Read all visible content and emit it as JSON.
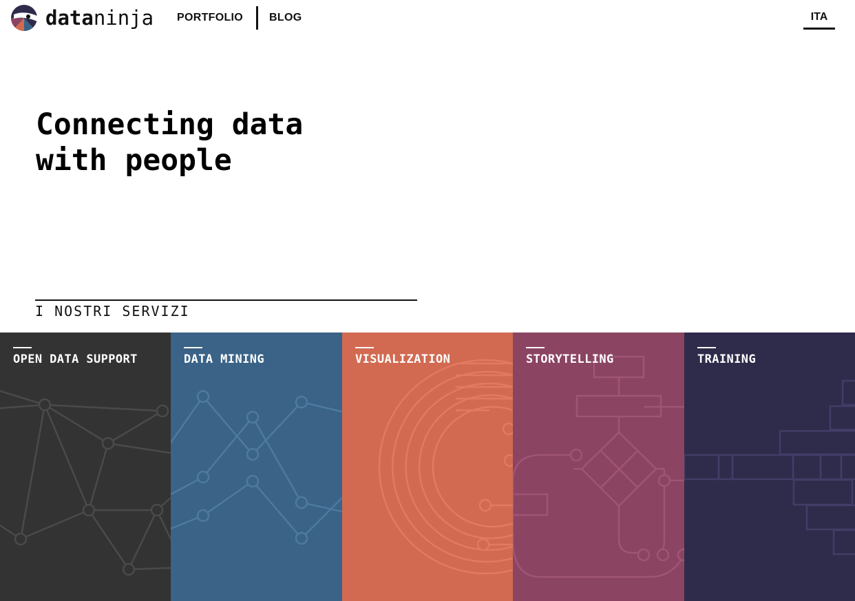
{
  "brand": {
    "name_bold": "data",
    "name_light": "ninja",
    "icon": "ninja-logo-icon"
  },
  "nav": {
    "items": [
      {
        "label": "PORTFOLIO"
      },
      {
        "label": "BLOG"
      }
    ],
    "language": "ITA"
  },
  "hero": {
    "line1": "Connecting data",
    "line2": "with people"
  },
  "services": {
    "title": "I NOSTRI SERVIZI",
    "items": [
      {
        "label": "OPEN DATA SUPPORT",
        "color": "#333333",
        "icon": "network-graph-pattern"
      },
      {
        "label": "DATA MINING",
        "color": "#3a6387",
        "icon": "line-chart-pattern"
      },
      {
        "label": "VISUALIZATION",
        "color": "#d26a52",
        "icon": "concentric-arcs-pattern"
      },
      {
        "label": "STORYTELLING",
        "color": "#8b4462",
        "icon": "flowchart-pattern"
      },
      {
        "label": "TRAINING",
        "color": "#2f2b4b",
        "icon": "brick-wall-pattern"
      }
    ]
  }
}
